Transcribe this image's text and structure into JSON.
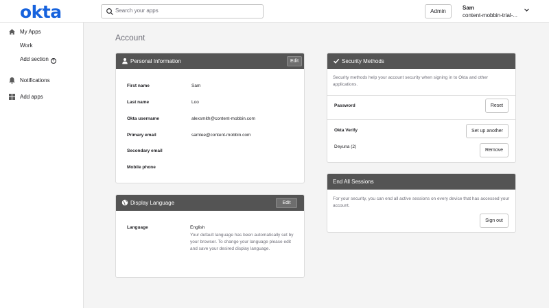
{
  "brand": {
    "logo_text": "okta",
    "accent": "#1662dd"
  },
  "header": {
    "search_placeholder": "Search your apps",
    "admin_label": "Admin",
    "user_name": "Sam",
    "user_org": "content-mobbin-trial-..."
  },
  "sidebar": {
    "items": [
      {
        "label": "My Apps",
        "icon": "home-icon"
      },
      {
        "label": "Work",
        "icon": ""
      },
      {
        "label": "Add section",
        "icon": "plus-circle-icon"
      },
      {
        "label": "Notifications",
        "icon": "bell-icon"
      },
      {
        "label": "Add apps",
        "icon": "grid-icon"
      }
    ]
  },
  "page": {
    "title": "Account"
  },
  "personal": {
    "title": "Personal Information",
    "edit_label": "Edit",
    "fields": [
      {
        "label": "First name",
        "value": "Sam"
      },
      {
        "label": "Last name",
        "value": "Loo"
      },
      {
        "label": "Okta username",
        "value": "alexsmith@content-mobbin.com"
      },
      {
        "label": "Primary email",
        "value": "samlee@content-mobbin.com"
      },
      {
        "label": "Secondary email",
        "value": ""
      },
      {
        "label": "Mobile phone",
        "value": ""
      }
    ]
  },
  "language": {
    "title": "Display Language",
    "edit_label": "Edit",
    "label": "Language",
    "value": "English",
    "description": "Your default language has been automatically set by your browser. To change your language please edit and save your desired display language."
  },
  "security": {
    "title": "Security Methods",
    "description": "Security methods help your account security when signing in to Okta and other applications.",
    "password_label": "Password",
    "reset_label": "Reset",
    "okta_verify_label": "Okta Verify",
    "setup_label": "Set up another",
    "device_label": "Deyuna (2)",
    "remove_label": "Remove"
  },
  "sessions": {
    "title": "End All Sessions",
    "description": "For your security, you can end all active sessions on every device that has accessed your account.",
    "signout_label": "Sign out"
  }
}
